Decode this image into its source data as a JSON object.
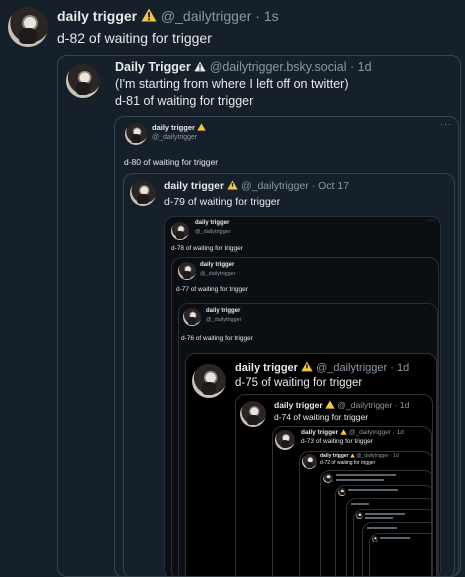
{
  "post": {
    "name": "daily trigger",
    "handle": "@_dailytrigger · 1s",
    "text": "d-82 of waiting for trigger"
  },
  "quote81": {
    "name": "Daily Trigger",
    "handle": "@dailytrigger.bsky.social · 1d",
    "line1": "(I'm starting from where I left off on twitter)",
    "line2": "d-81 of waiting for trigger"
  },
  "quote80": {
    "name": "daily trigger",
    "handle": "@_dailytrigger",
    "text": "d-80 of waiting for trigger"
  },
  "quote79": {
    "name": "daily trigger",
    "handle": "@_dailytrigger · Oct 17",
    "text": "d-79 of waiting for trigger"
  },
  "quote78": {
    "name": "daily trigger",
    "handle": "@_dailytrigger",
    "text": "d-78 of waiting for trigger"
  },
  "quote77": {
    "name": "daily trigger",
    "handle": "@_dailytrigger",
    "text": "d-77 of waiting for trigger"
  },
  "quote76": {
    "name": "daily trigger",
    "handle": "@_dailytrigger",
    "text": "d-76 of waiting for trigger"
  },
  "quote75": {
    "name": "daily trigger",
    "handle": "@_dailytrigger · 1d",
    "text": "d-75 of waiting for trigger"
  },
  "quote74": {
    "name": "daily trigger",
    "handle": "@_dailytrigger · 1d",
    "text": "d-74 of waiting for trigger"
  },
  "quote73": {
    "name": "daily trigger",
    "handle": "@_dailytrigger · 1d",
    "text": "d-73 of waiting for trigger"
  },
  "quote72": {
    "name": "daily trigger",
    "handle": "@_dailytrigger · 1d",
    "text": "d-72 of waiting for trigger"
  },
  "more_dots": "···",
  "colors": {
    "background": "#15202b",
    "text": "#e7e9ea",
    "muted": "#8b98a5",
    "border": "#38444d",
    "warning": "#f4c542"
  }
}
